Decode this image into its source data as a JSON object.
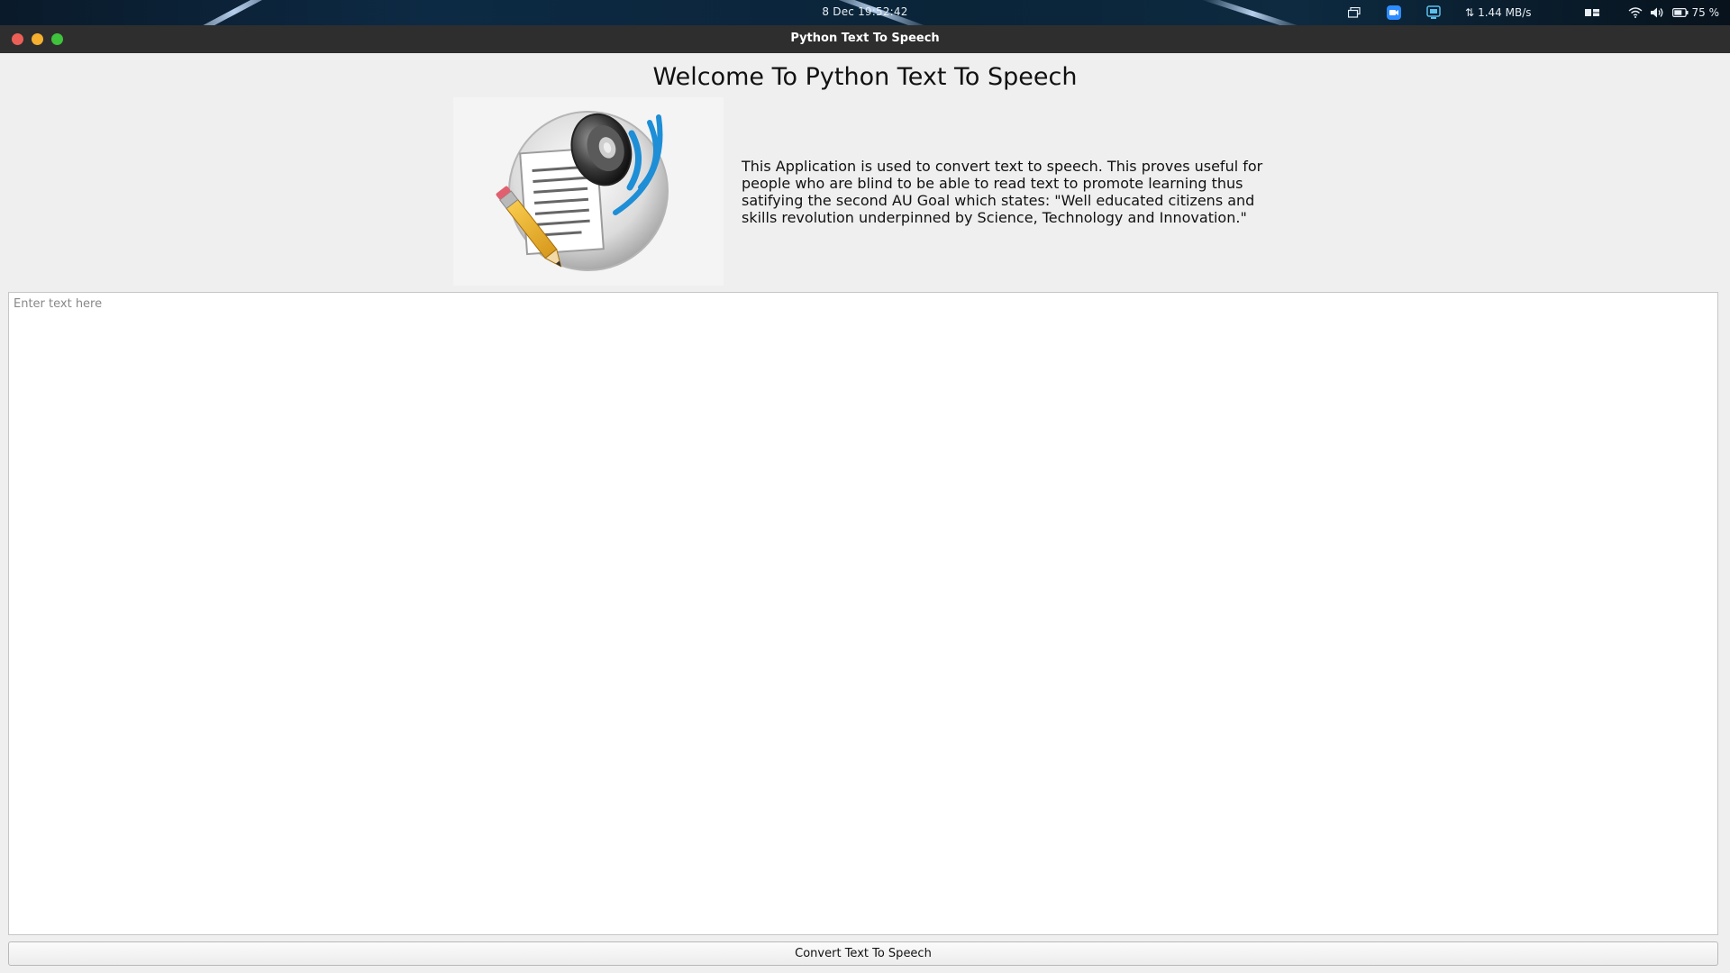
{
  "system_bar": {
    "clock": "8 Dec  19:52:42",
    "net_speed": "1.44 MB/s",
    "battery": "75 %",
    "tray_icons": [
      "window-switcher-icon",
      "zoom-icon",
      "screenshot-icon",
      "network-speed-icon",
      "layout-icon",
      "wifi-icon",
      "volume-icon",
      "battery-icon"
    ]
  },
  "window": {
    "title": "Python Text To Speech",
    "heading": "Welcome To Python Text To Speech",
    "description": "This Application is used to convert text to speech. This proves useful for people who are blind to be able to read text to promote learning thus satifying the second AU Goal which states: \"Well educated citizens and skills revolution underpinned by Science, Technology and Innovation.\"",
    "logo_icon": "speaker-document-icon",
    "text_input": {
      "value": "",
      "placeholder": "Enter text here"
    },
    "convert_button_label": "Convert Text To Speech"
  },
  "colors": {
    "close": "#ec5f57",
    "minimize": "#f4b02e",
    "maximize": "#3fc23c",
    "titlebar": "#2e2e2e",
    "window_bg": "#efefef",
    "accent_blue": "#1e8ed6"
  }
}
